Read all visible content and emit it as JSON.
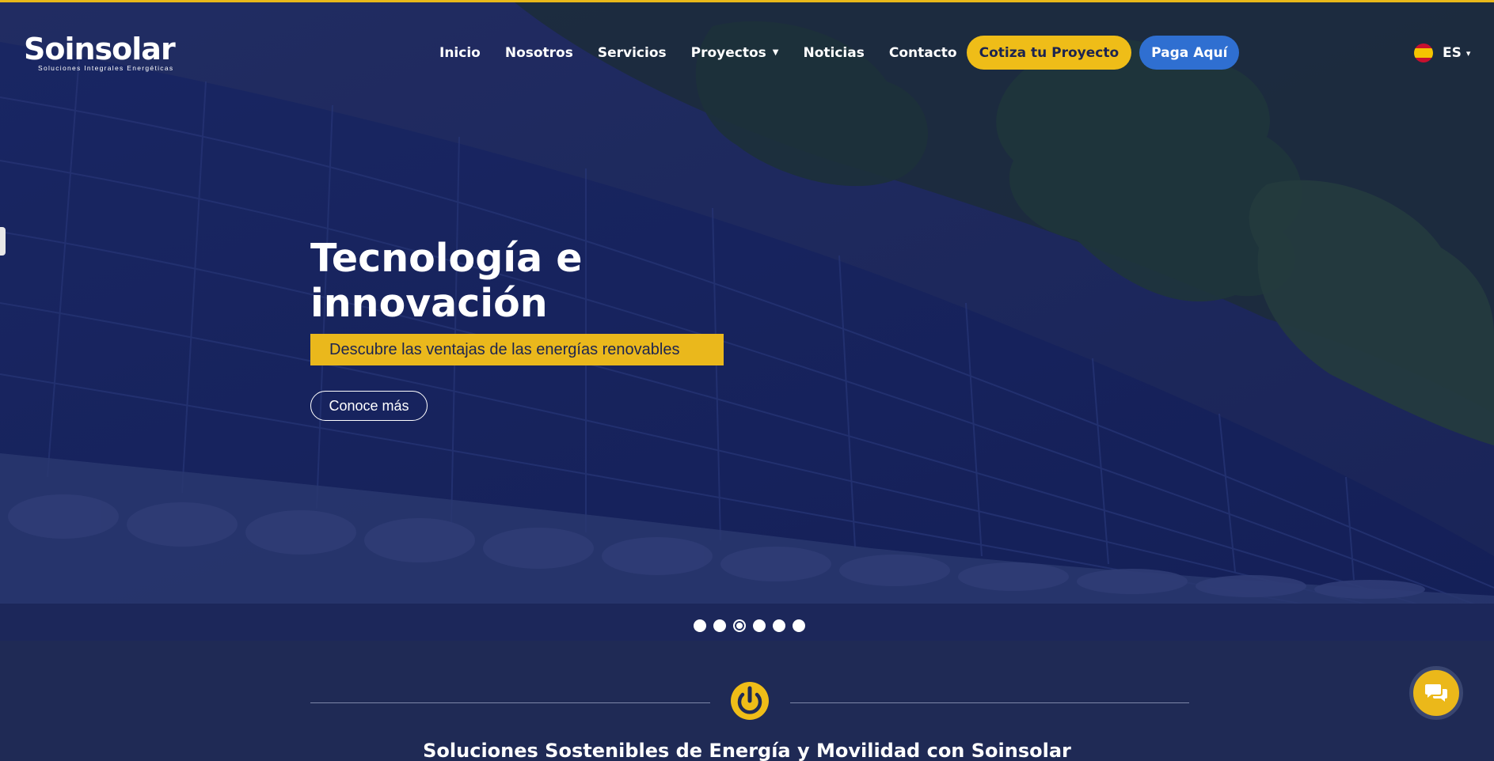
{
  "brand": {
    "name": "Soinsolar",
    "tagline": "Soluciones Integrales Energéticas"
  },
  "nav": {
    "items": [
      {
        "label": "Inicio"
      },
      {
        "label": "Nosotros"
      },
      {
        "label": "Servicios"
      },
      {
        "label": "Proyectos",
        "has_dropdown": true
      },
      {
        "label": "Noticias"
      },
      {
        "label": "Contacto"
      }
    ],
    "cta_quote": "Cotiza tu Proyecto",
    "cta_pay": "Paga Aquí"
  },
  "language": {
    "selected": "ES",
    "flag_icon": "spain-flag-icon"
  },
  "hero": {
    "headline": "Tecnología e innovación",
    "subline": "Descubre las ventajas de las energías renovables",
    "cta": "Conoce más",
    "slides_total": 6,
    "active_slide": 3
  },
  "section": {
    "icon": "power-icon",
    "title": "Soluciones Sostenibles de Energía y Movilidad con Soinsolar"
  },
  "chat": {
    "icon": "chat-bubbles-icon"
  },
  "colors": {
    "accent_yellow": "#EFBD18",
    "accent_blue": "#2F6FD1",
    "navy": "#1F2A55"
  }
}
